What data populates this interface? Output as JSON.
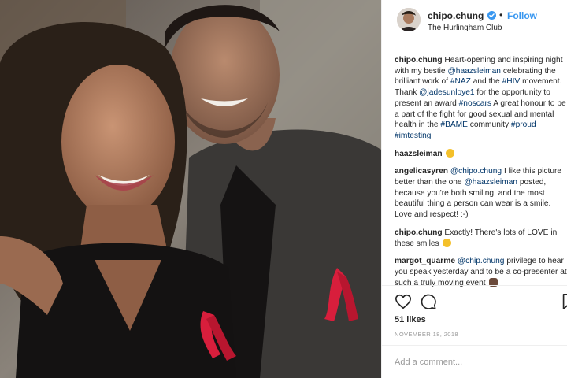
{
  "post": {
    "username": "chipo.chung",
    "follow_label": "Follow",
    "location": "The Hurlingham Club",
    "separator": "•"
  },
  "comments": [
    {
      "user": "chipo.chung",
      "text": "Heart-opening and inspiring night with my bestie @haazsleiman celebrating the brilliant work of #NAZ and the #HIV movement. Thank @jadesunloye1 for the opportunity to present an award #noscars A great honour to be a part of the fight for good sexual and mental health in the #BAME community #proud #imtesting"
    },
    {
      "user": "haazsleiman",
      "text": "",
      "emoji": "grin-emoji"
    },
    {
      "user": "angelicasyren",
      "text": "@chipo.chung I like this picture better than the one @haazsleiman posted, because you're both smiling, and the most beautiful thing a person can wear is a smile. Love and respect! :-)"
    },
    {
      "user": "chipo.chung",
      "text": "Exactly! There's lots of LOVE in these smiles",
      "emoji": "smile-emoji"
    },
    {
      "user": "margot_quarme",
      "text": "@chip.chung privilege to hear you speak yesterday and to be a co-presenter at such a truly moving event",
      "emoji": "praying-hands-emoji"
    }
  ],
  "actions": {
    "like_icon": "heart-icon",
    "comment_icon": "speech-bubble-icon",
    "save_icon": "bookmark-icon"
  },
  "likes": "51 likes",
  "date": "NOVEMBER 18, 2018",
  "add_comment_placeholder": "Add a comment...",
  "colors": {
    "link": "#3897f0",
    "mention": "#003569",
    "text": "#262626",
    "muted": "#999999",
    "ribbon": "#d81e3c"
  }
}
